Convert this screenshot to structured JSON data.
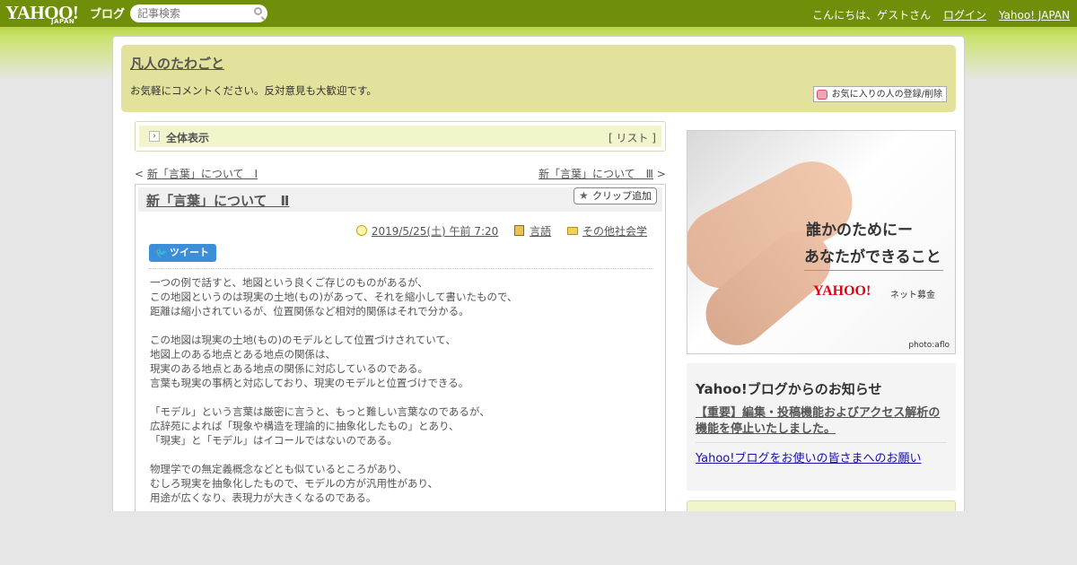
{
  "topbar": {
    "logo": "YAHOO!",
    "logo_sub": "JAPAN",
    "logo_blog": "ブログ",
    "search_placeholder": "記事検索",
    "greeting": "こんにちは、ゲストさん",
    "login": "ログイン",
    "yahoo_japan": "Yahoo! JAPAN"
  },
  "blog": {
    "title": "凡人のたわごと",
    "description": "お気軽にコメントください。反対意見も大歓迎です。",
    "fav_button": "お気に入りの人の登録/削除"
  },
  "nav": {
    "all_view": "全体表示",
    "list_link": "[ リスト ]",
    "prev": "新「言葉」について　Ⅰ",
    "next": "新「言葉」について　Ⅲ"
  },
  "article": {
    "title": "新「言葉」について　Ⅱ",
    "clip_button": "クリップ追加",
    "date": "2019/5/25(土) 午前 7:20",
    "category": "言語",
    "tag": "その他社会学",
    "tweet": "ツイート",
    "paragraphs": [
      [
        "一つの例で話すと、地図という良くご存じのものがあるが、",
        "この地図というのは現実の土地(もの)があって、それを縮小して書いたもので、",
        "距離は縮小されているが、位置関係など相対的関係はそれで分かる。"
      ],
      [
        "この地図は現実の土地(もの)のモデルとして位置づけされていて、",
        "地図上のある地点とある地点の関係は、",
        "現実のある地点とある地点の関係に対応しているのである。",
        "言葉も現実の事柄と対応しており、現実のモデルと位置づけできる。"
      ],
      [
        "「モデル」という言葉は厳密に言うと、もっと難しい言葉なのであるが、",
        "広辞苑によれば「現象や構造を理論的に抽象化したもの」とあり、",
        "「現実」と「モデル」はイコールではないのである。"
      ],
      [
        "物理学での無定義概念などとも似ているところがあり、",
        "むしろ現実を抽象化したもので、モデルの方が汎用性があり、",
        "用途が広くなり、表現力が大きくなるのである。"
      ]
    ]
  },
  "ad": {
    "line1": "誰かのためにー",
    "line2": "あなたができること",
    "logo": "YAHOO!",
    "logo_sub": "ネット募金",
    "credit": "photo:aflo"
  },
  "notice": {
    "title": "Yahoo!ブログからのお知らせ",
    "link1": "【重要】編集・投稿機能およびアクセス解析の機能を停止いたしました。",
    "link2": "Yahoo!ブログをお使いの皆さまへのお願い"
  }
}
